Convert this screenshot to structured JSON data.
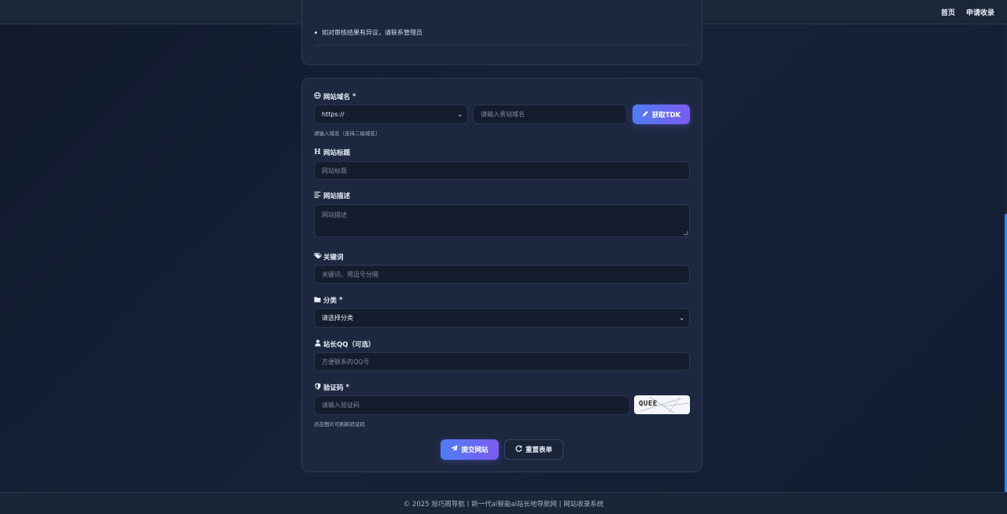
{
  "nav": {
    "home": "首页",
    "apply": "申请收录"
  },
  "info": {
    "notice": "如对审核结果有异议，请联系管理员"
  },
  "form": {
    "domain": {
      "label": "网站域名",
      "required": "*",
      "protocol": "https://",
      "placeholder": "请输入贵站域名",
      "button": "获取TDK",
      "hint": "请输入域名（支持二级域名）"
    },
    "title": {
      "label": "网站标题",
      "placeholder": "网站标题"
    },
    "description": {
      "label": "网站描述",
      "placeholder": "网站描述"
    },
    "keywords": {
      "label": "关键词",
      "placeholder": "关键词，用逗号分隔"
    },
    "category": {
      "label": "分类",
      "required": "*",
      "selected": "请选择分类"
    },
    "qq": {
      "label": "站长QQ（可选）",
      "placeholder": "方便联系的QQ号"
    },
    "captcha": {
      "label": "验证码",
      "required": "*",
      "placeholder": "请输入验证码",
      "image_text": "QUEE",
      "hint": "点击图片可刷新验证码"
    },
    "submit": "提交网站",
    "reset": "重置表单"
  },
  "footer": {
    "text": "© 2025 旭巧阁导航丨新一代ai智能ai站长地导航网 | 网站收录系统"
  },
  "icons": {
    "globe": "globe-icon",
    "heading": "heading-icon",
    "align": "align-left-icon",
    "tags": "tags-icon",
    "folder": "folder-icon",
    "user": "user-icon",
    "shield": "shield-icon",
    "pen": "pen-icon",
    "plane": "paper-plane-icon",
    "redo": "redo-icon"
  },
  "colors": {
    "accent_start": "#4f7df2",
    "accent_end": "#7a5cf0",
    "scroll_thumb": "#3c82e6"
  }
}
